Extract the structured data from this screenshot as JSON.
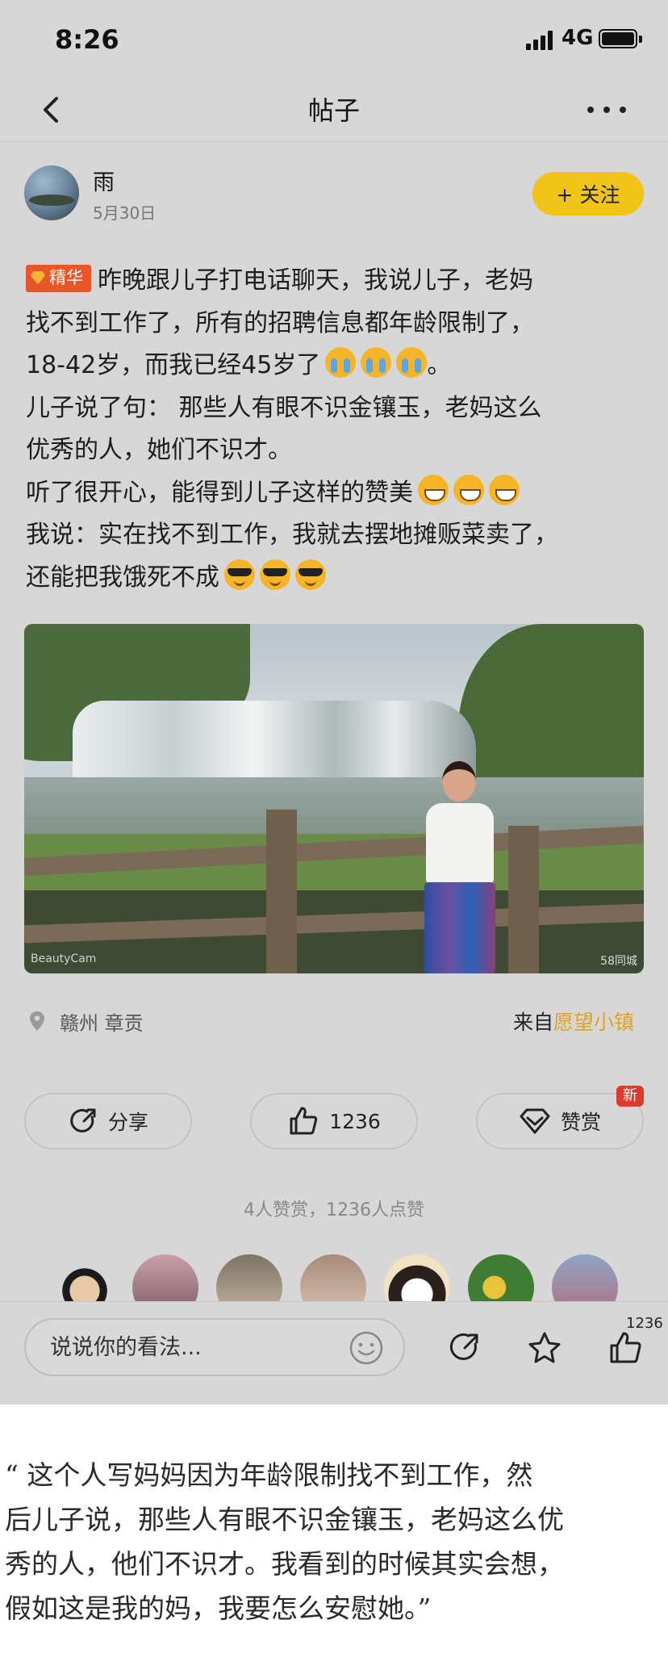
{
  "status_bar": {
    "time": "8:26",
    "network": "4G"
  },
  "nav": {
    "title": "帖子"
  },
  "author": {
    "name": "雨",
    "date": "5月30日",
    "follow_label": "+ 关注"
  },
  "post": {
    "badge": "精华",
    "lines": [
      "昨晚跟儿子打电话聊天，我说儿子，老妈",
      "找不到工作了，所有的招聘信息都年龄限制了，",
      "18-42岁，而我已经45岁了",
      "。",
      "儿子说了句： 那些人有眼不识金镶玉，老妈这么",
      "优秀的人，她们不识才。",
      "听了很开心，能得到儿子这样的赞美",
      "我说：实在找不到工作，我就去摆地摊贩菜卖了，",
      "还能把我饿死不成"
    ],
    "emoji": {
      "cry": "loudly-crying-face-emoji",
      "grin": "grinning-face-emoji",
      "cool": "sunglasses-face-emoji"
    }
  },
  "photo": {
    "watermark_left": "BeautyCam",
    "watermark_right": "58同城"
  },
  "location": {
    "text": "赣州 章贡",
    "from_prefix": "来自",
    "app_name": "愿望小镇"
  },
  "actions": {
    "share": "分享",
    "likes": "1236",
    "reward": "赞赏",
    "new_badge": "新"
  },
  "reward_summary": "4人赞赏，1236人点赞",
  "bottom_bar": {
    "placeholder": "说说你的看法...",
    "like_count": "1236"
  },
  "caption_lines": [
    "“ 这个人写妈妈因为年龄限制找不到工作，然",
    "后儿子说，那些人有眼不识金镶玉，老妈这么优",
    "秀的人，他们不识才。我看到的时候其实会想，",
    "假如这是我的妈，我要怎么安慰她。”"
  ],
  "colors": {
    "accent_yellow": "#f0c419",
    "badge_orange": "#e8562a",
    "app_name_gold": "#e0a31b",
    "new_red": "#e03a2f"
  }
}
